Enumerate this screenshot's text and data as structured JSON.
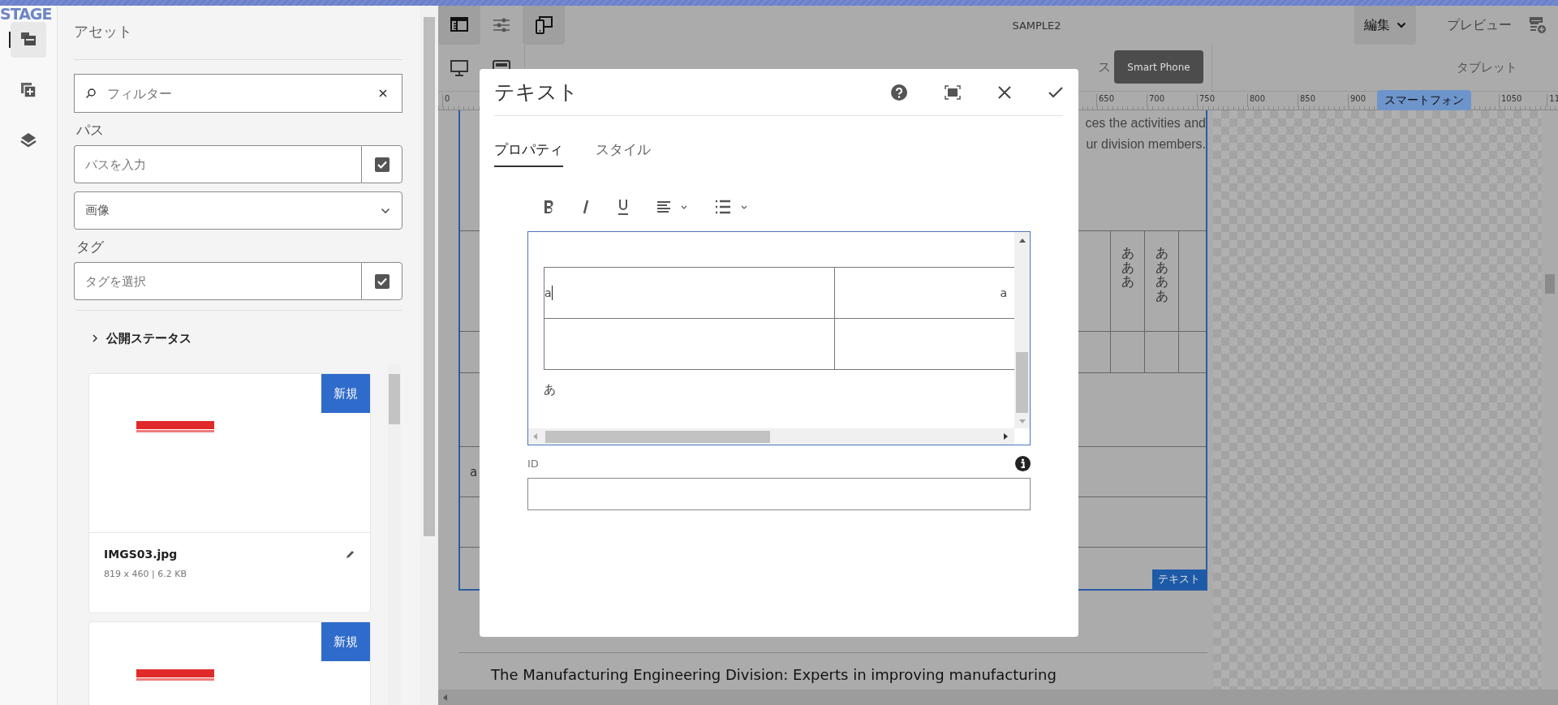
{
  "environment_label": "STAGE",
  "rail": [
    {
      "selected": true
    },
    {
      "selected": false
    },
    {
      "selected": false
    }
  ],
  "assets_panel": {
    "title": "アセット",
    "filter": {
      "placeholder": "フィルター"
    },
    "path_label": "パス",
    "path_field": {
      "placeholder": "パスを入力"
    },
    "type_select": {
      "value": "画像"
    },
    "tag_label": "タグ",
    "tag_field": {
      "placeholder": "タグを選択"
    },
    "publish_status": {
      "label": "公開ステータス",
      "expanded": false
    },
    "cards": [
      {
        "kind": "full",
        "badge": "新規",
        "name": "IMGS03.jpg",
        "meta": "819 x 460 | 6.2 KB"
      },
      {
        "kind": "partial",
        "badge": "新規"
      }
    ]
  },
  "toolbar": {
    "buttons": [
      {
        "selected": true
      },
      {
        "selected": false
      },
      {
        "selected": true
      }
    ],
    "title": "SAMPLE2",
    "mode": "編集",
    "preview": "プレビュー"
  },
  "device_bar": {
    "partial_label": "ス",
    "tooltip": "Smart Phone",
    "tablet": "タブレット"
  },
  "ruler": {
    "labels": [
      "0",
      "650",
      "700",
      "750",
      "800",
      "850",
      "900",
      "1050",
      "11"
    ],
    "marker": "スマートフォン"
  },
  "page": {
    "lines": [
      "ces the activities and",
      "ur division members."
    ],
    "vertical_cells": [
      "あああ",
      "ああああ"
    ],
    "cell_text": "a",
    "component_label": "テキスト",
    "heading": "The Manufacturing Engineering Division: Experts in improving manufacturing"
  },
  "dialog": {
    "title": "テキスト",
    "tabs": [
      {
        "label": "プロパティ",
        "selected": true
      },
      {
        "label": "スタイル",
        "selected": false
      }
    ],
    "editor": {
      "rows": [
        {
          "kind": "text",
          "cells": [
            "a",
            "a"
          ]
        },
        {
          "kind": "empty"
        }
      ],
      "paragraph": "あ"
    },
    "id_field": {
      "label": "ID"
    }
  }
}
